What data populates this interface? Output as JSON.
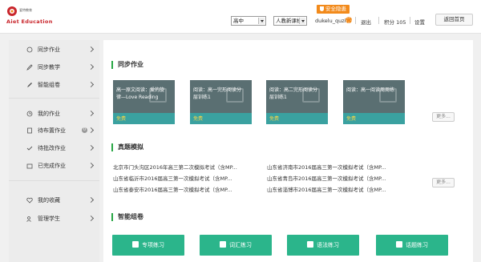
{
  "header": {
    "logo_small": "爱特教育",
    "logo_text": "Aiet Education",
    "security_label": "安全隐患",
    "grade_select": "高中",
    "textbook_select": "人教新课标",
    "username": "dukelu_quzi",
    "logout": "退出",
    "points": "积分 105",
    "settings": "设置",
    "home_button": "返回首页"
  },
  "sidebar": {
    "items": [
      {
        "label": "同步作业"
      },
      {
        "label": "同步教学"
      },
      {
        "label": "智能组卷"
      },
      {
        "label": "我的作业"
      },
      {
        "label": "待布置作业",
        "badge": "0"
      },
      {
        "label": "待批改作业"
      },
      {
        "label": "已完成作业"
      },
      {
        "label": "我的收藏"
      },
      {
        "label": "管理学生"
      }
    ]
  },
  "main": {
    "sync_homework": {
      "title": "同步作业",
      "cards": [
        {
          "title": "高一原文阅读：爱的旋律—Love Reading",
          "tag": "免费"
        },
        {
          "title": "阅读：高一完形阅读分层训练1",
          "tag": "免费"
        },
        {
          "title": "阅读：高二完形阅读分层训练1",
          "tag": "免费"
        },
        {
          "title": "阅读：高一阅读周周练",
          "tag": "免费"
        }
      ],
      "more": "更多..."
    },
    "real_exams": {
      "title": "真题模拟",
      "rows": [
        [
          "北京市门头沟区2016年高三第二次模拟考试（含MP...",
          "山东省济南市2016届高三第一次模拟考试（含MP..."
        ],
        [
          "山东省临沂市2016届高三第一次模拟考试（含MP...",
          "山东省青岛市2016届高三第一次模拟考试（含MP..."
        ],
        [
          "山东省泰安市2016届高三第一次模拟考试（含MP...",
          "山东省淄博市2016届高三第一次模拟考试（含MP..."
        ]
      ],
      "more": "更多..."
    },
    "smart_paper": {
      "title": "智能组卷",
      "buttons": [
        "专项练习",
        "词汇练习",
        "语法练习",
        "话题练习"
      ]
    }
  },
  "colors": {
    "accent_green": "#2bb58b",
    "brand_red": "#c9262c",
    "security_orange": "#f28a1b",
    "card_teal": "#3aa1a0"
  }
}
